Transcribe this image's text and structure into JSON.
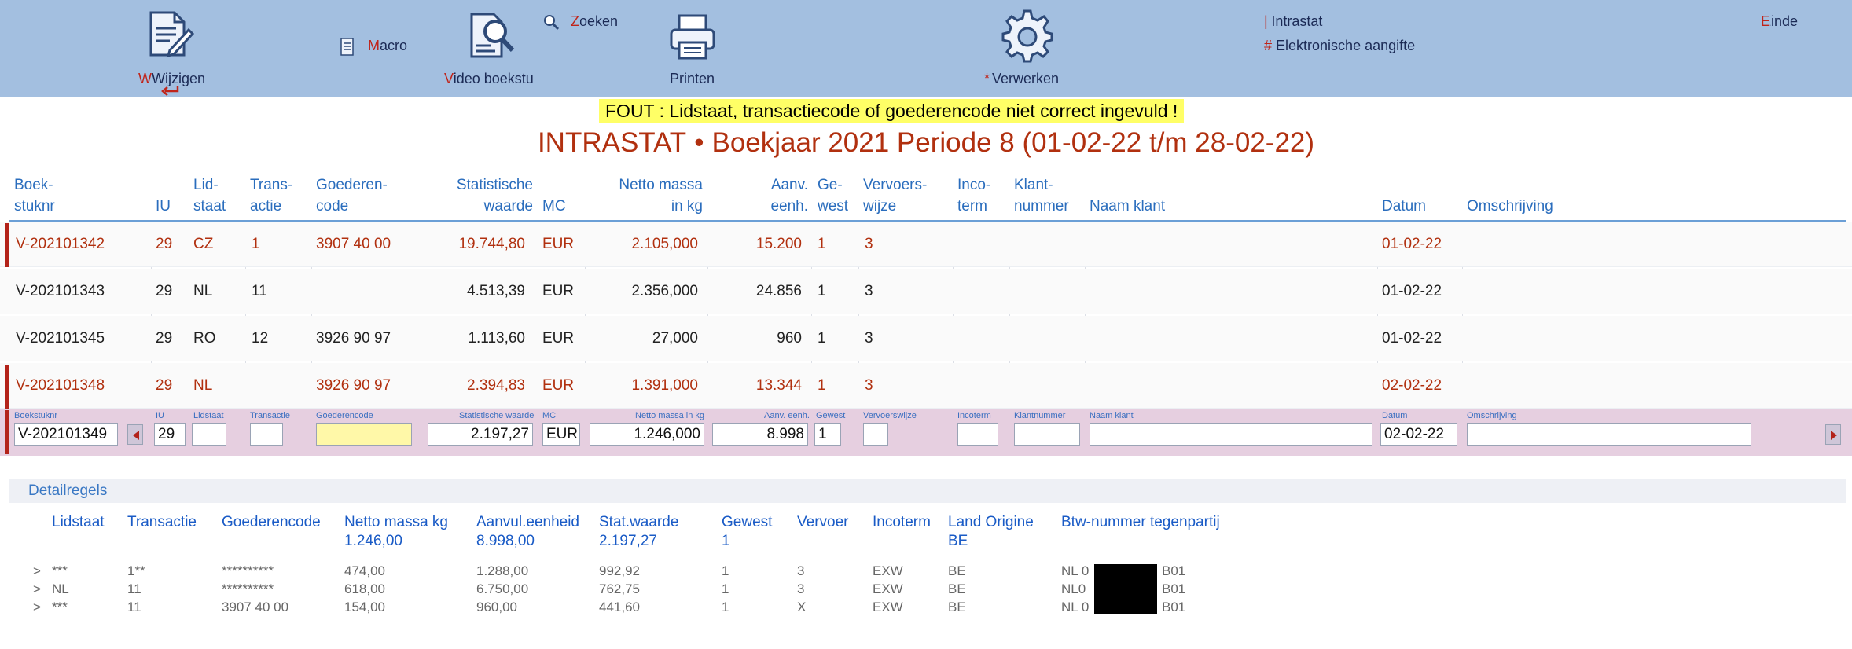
{
  "toolbar": {
    "wijzigen": "Wijzigen",
    "macro": "Macro",
    "video": "Video boekstu",
    "zoeken": "Zoeken",
    "printen": "Printen",
    "verwerken": "* Verwerken",
    "intrastat": "| Intrastat",
    "elektronisch": "# Elektronische aangifte",
    "einde": "Einde"
  },
  "error": "FOUT : Lidstaat, transactiecode of goederencode niet correct ingevuld  !",
  "title": {
    "main": "INTRASTAT",
    "sep": "•",
    "sub": "Boekjaar 2021 Periode 8 (01-02-22 t/m 28-02-22)"
  },
  "columns": {
    "boekstuknr": [
      "Boek-",
      "stuknr"
    ],
    "iu": "IU",
    "lidstaat": [
      "Lid-",
      "staat"
    ],
    "transactie": [
      "Trans-",
      "actie"
    ],
    "goederencode": [
      "Goederen-",
      "code"
    ],
    "statwaarde": [
      "Statistische",
      "waarde"
    ],
    "mc": "MC",
    "netto": [
      "Netto massa",
      "in kg"
    ],
    "aanv": [
      "Aanv.",
      "eenh."
    ],
    "gewest": [
      "Ge-",
      "west"
    ],
    "vervoer": [
      "Vervoers-",
      "wijze"
    ],
    "incoterm": [
      "Inco-",
      "term"
    ],
    "klantnr": [
      "Klant-",
      "nummer"
    ],
    "naam": "Naam klant",
    "datum": "Datum",
    "omschrijving": "Omschrijving"
  },
  "rows": [
    {
      "error": true,
      "boekstuknr": "V-202101342",
      "iu": "29",
      "lidstaat": "CZ",
      "transactie": "1",
      "goederencode": "3907 40 00",
      "statwaarde": "19.744,80",
      "mc": "EUR",
      "netto": "2.105,000",
      "aanv": "15.200",
      "gewest": "1",
      "vervoer": "3",
      "datum": "01-02-22"
    },
    {
      "error": false,
      "boekstuknr": "V-202101343",
      "iu": "29",
      "lidstaat": "NL",
      "transactie": "11",
      "goederencode": "",
      "statwaarde": "4.513,39",
      "mc": "EUR",
      "netto": "2.356,000",
      "aanv": "24.856",
      "gewest": "1",
      "vervoer": "3",
      "datum": "01-02-22"
    },
    {
      "error": false,
      "boekstuknr": "V-202101345",
      "iu": "29",
      "lidstaat": "RO",
      "transactie": "12",
      "goederencode": "3926 90 97",
      "statwaarde": "1.113,60",
      "mc": "EUR",
      "netto": "27,000",
      "aanv": "960",
      "gewest": "1",
      "vervoer": "3",
      "datum": "01-02-22"
    },
    {
      "error": true,
      "boekstuknr": "V-202101348",
      "iu": "29",
      "lidstaat": "NL",
      "transactie": "",
      "goederencode": "3926 90 97",
      "statwaarde": "2.394,83",
      "mc": "EUR",
      "netto": "1.391,000",
      "aanv": "13.344",
      "gewest": "1",
      "vervoer": "3",
      "datum": "02-02-22"
    }
  ],
  "edit": {
    "labels": {
      "boekstuknr": "Boekstuknr",
      "iu": "IU",
      "lidstaat": "Lidstaat",
      "transactie": "Transactie",
      "goederencode": "Goederencode",
      "statwaarde": "Statistische waarde",
      "mc": "MC",
      "netto": "Netto massa in kg",
      "aanv": "Aanv. eenh.",
      "gewest": "Gewest",
      "vervoer": "Vervoerswijze",
      "incoterm": "Incoterm",
      "klantnr": "Klantnummer",
      "naam": "Naam klant",
      "datum": "Datum",
      "omschrijving": "Omschrijving"
    },
    "values": {
      "boekstuknr": "V-202101349",
      "iu": "29",
      "lidstaat": "",
      "transactie": "",
      "goederencode": "",
      "statwaarde": "2.197,27",
      "mc": "EUR",
      "netto": "1.246,000",
      "aanv": "8.998",
      "gewest": "1",
      "vervoer": "",
      "incoterm": "",
      "klantnr": "",
      "naam": "",
      "datum": "02-02-22",
      "omschrijving": ""
    }
  },
  "detail": {
    "title": "Detailregels",
    "headers": {
      "lidstaat": "Lidstaat",
      "transactie": "Transactie",
      "goederencode": "Goederencode",
      "netto": "Netto massa kg",
      "aanvul": "Aanvul.eenheid",
      "statwaarde": "Stat.waarde",
      "gewest": "Gewest",
      "vervoer": "Vervoer",
      "incoterm": "Incoterm",
      "land": "Land Origine",
      "btw": "Btw-nummer tegenpartij"
    },
    "totals": {
      "netto": "1.246,00",
      "aanvul": "8.998,00",
      "statwaarde": "2.197,27",
      "gewest": "1",
      "land": "BE"
    },
    "lines": [
      {
        "marker": ">",
        "lidstaat": "***",
        "transactie": "1**",
        "goederencode": "**********",
        "netto": "474,00",
        "aanvul": "1.288,00",
        "statwaarde": "992,92",
        "gewest": "1",
        "vervoer": "3",
        "incoterm": "EXW",
        "land": "BE",
        "btw_pre": "NL 0",
        "btw_post": "B01"
      },
      {
        "marker": ">",
        "lidstaat": "NL",
        "transactie": "11",
        "goederencode": "**********",
        "netto": "618,00",
        "aanvul": "6.750,00",
        "statwaarde": "762,75",
        "gewest": "1",
        "vervoer": "3",
        "incoterm": "EXW",
        "land": "BE",
        "btw_pre": "NL0",
        "btw_post": "B01"
      },
      {
        "marker": ">",
        "lidstaat": "***",
        "transactie": "11",
        "goederencode": "3907 40 00",
        "netto": "154,00",
        "aanvul": "960,00",
        "statwaarde": "441,60",
        "gewest": "1",
        "vervoer": "X",
        "incoterm": "EXW",
        "land": "BE",
        "btw_pre": "NL 0",
        "btw_post": "B01"
      }
    ]
  }
}
